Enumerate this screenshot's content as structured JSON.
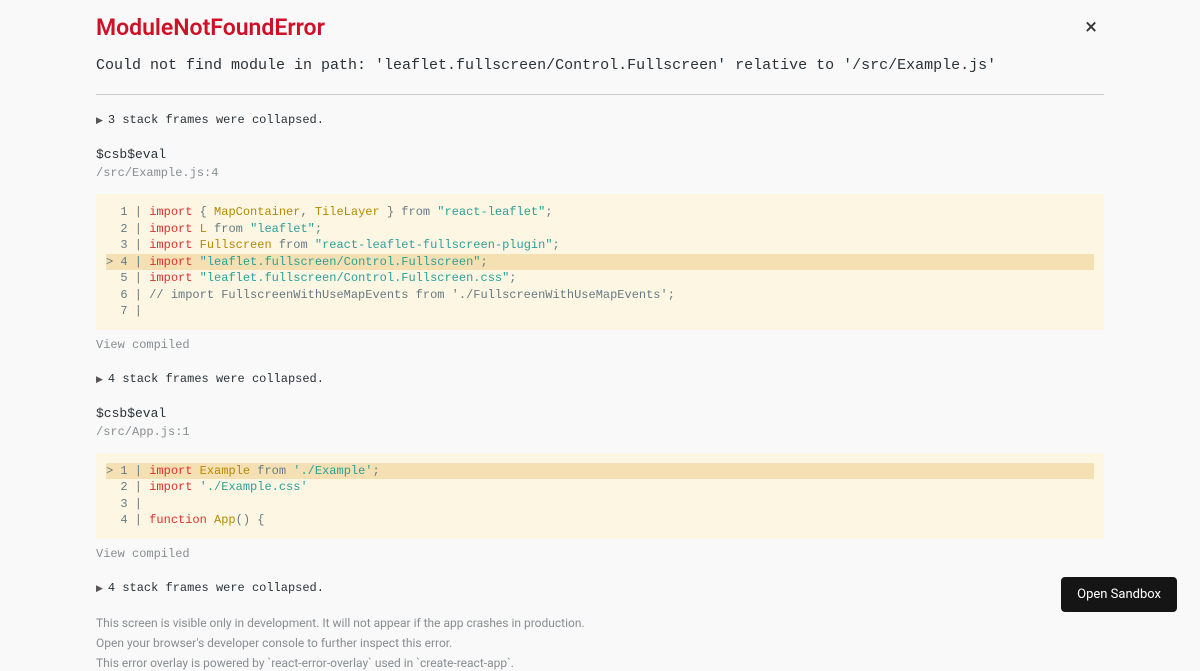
{
  "error": {
    "title": "ModuleNotFoundError",
    "message": "Could not find module in path: 'leaflet.fullscreen/Control.Fullscreen' relative to '/src/Example.js'"
  },
  "close_label": "×",
  "collapse1": "3 stack frames were collapsed.",
  "frame1": {
    "function_name": "$csb$eval",
    "location": "/src/Example.js:4",
    "code": [
      {
        "n": "1",
        "prefix": "  ",
        "highlighted": false,
        "parts": [
          {
            "c": "keyword",
            "t": "import"
          },
          {
            "c": "plain",
            "t": " { "
          },
          {
            "c": "identifier",
            "t": "MapContainer"
          },
          {
            "c": "plain",
            "t": ", "
          },
          {
            "c": "identifier",
            "t": "TileLayer"
          },
          {
            "c": "plain",
            "t": " } from "
          },
          {
            "c": "string",
            "t": "\"react-leaflet\""
          },
          {
            "c": "plain",
            "t": ";"
          }
        ]
      },
      {
        "n": "2",
        "prefix": "  ",
        "highlighted": false,
        "parts": [
          {
            "c": "keyword",
            "t": "import"
          },
          {
            "c": "plain",
            "t": " "
          },
          {
            "c": "identifier",
            "t": "L"
          },
          {
            "c": "plain",
            "t": " from "
          },
          {
            "c": "string",
            "t": "\"leaflet\""
          },
          {
            "c": "plain",
            "t": ";"
          }
        ]
      },
      {
        "n": "3",
        "prefix": "  ",
        "highlighted": false,
        "parts": [
          {
            "c": "keyword",
            "t": "import"
          },
          {
            "c": "plain",
            "t": " "
          },
          {
            "c": "identifier",
            "t": "Fullscreen"
          },
          {
            "c": "plain",
            "t": " from "
          },
          {
            "c": "string",
            "t": "\"react-leaflet-fullscreen-plugin\""
          },
          {
            "c": "plain",
            "t": ";"
          }
        ]
      },
      {
        "n": "4",
        "prefix": "> ",
        "highlighted": true,
        "parts": [
          {
            "c": "keyword",
            "t": "import"
          },
          {
            "c": "plain",
            "t": " "
          },
          {
            "c": "string",
            "t": "\"leaflet.fullscreen/Control.Fullscreen\""
          },
          {
            "c": "plain",
            "t": ";"
          }
        ]
      },
      {
        "n": "5",
        "prefix": "  ",
        "highlighted": false,
        "parts": [
          {
            "c": "keyword",
            "t": "import"
          },
          {
            "c": "plain",
            "t": " "
          },
          {
            "c": "string",
            "t": "\"leaflet.fullscreen/Control.Fullscreen.css\""
          },
          {
            "c": "plain",
            "t": ";"
          }
        ]
      },
      {
        "n": "6",
        "prefix": "  ",
        "highlighted": false,
        "parts": [
          {
            "c": "plain",
            "t": "// import FullscreenWithUseMapEvents from './FullscreenWithUseMapEvents';"
          }
        ]
      },
      {
        "n": "7",
        "prefix": "  ",
        "highlighted": false,
        "parts": [
          {
            "c": "plain",
            "t": ""
          }
        ]
      }
    ]
  },
  "view_compiled": "View compiled",
  "collapse2": "4 stack frames were collapsed.",
  "frame2": {
    "function_name": "$csb$eval",
    "location": "/src/App.js:1",
    "code": [
      {
        "n": "1",
        "prefix": "> ",
        "highlighted": true,
        "parts": [
          {
            "c": "keyword",
            "t": "import"
          },
          {
            "c": "plain",
            "t": " "
          },
          {
            "c": "identifier",
            "t": "Example"
          },
          {
            "c": "plain",
            "t": " from "
          },
          {
            "c": "string",
            "t": "'./Example'"
          },
          {
            "c": "plain",
            "t": ";"
          }
        ]
      },
      {
        "n": "2",
        "prefix": "  ",
        "highlighted": false,
        "parts": [
          {
            "c": "keyword",
            "t": "import"
          },
          {
            "c": "plain",
            "t": " "
          },
          {
            "c": "string",
            "t": "'./Example.css'"
          }
        ]
      },
      {
        "n": "3",
        "prefix": "  ",
        "highlighted": false,
        "parts": [
          {
            "c": "plain",
            "t": ""
          }
        ]
      },
      {
        "n": "4",
        "prefix": "  ",
        "highlighted": false,
        "parts": [
          {
            "c": "keyword",
            "t": "function"
          },
          {
            "c": "plain",
            "t": " "
          },
          {
            "c": "identifier",
            "t": "App"
          },
          {
            "c": "plain",
            "t": "() {"
          }
        ]
      }
    ]
  },
  "collapse3": "4 stack frames were collapsed.",
  "footer": {
    "line1": "This screen is visible only in development. It will not appear if the app crashes in production.",
    "line2": "Open your browser's developer console to further inspect this error.",
    "line3": "This error overlay is powered by `react-error-overlay` used in `create-react-app`."
  },
  "open_sandbox": "Open Sandbox"
}
